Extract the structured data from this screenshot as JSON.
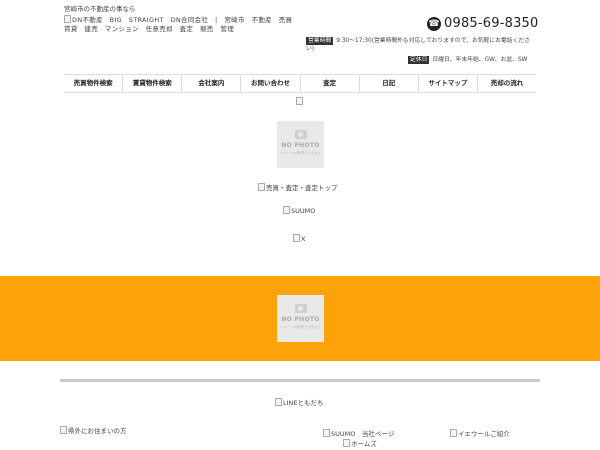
{
  "header": {
    "tagline": "宮崎市の不動産の事なら",
    "logo_alt": "DN不動産　BIG　STRAIGHT　DN合同会社　|　宮崎市　不動産　売買　賃貸　建売　マンション　任意売却　査定　競売　管理",
    "phone": "0985-69-8350",
    "hours_badge": "営業時間",
    "hours_text": "9:30～17:30(営業時間外も対応しておりますので、お気軽にお電話ください)",
    "holiday_badge": "定休日",
    "holiday_text": "日曜日、年末年始、GW、お盆、SW"
  },
  "nav": {
    "items": [
      {
        "label": "売買物件検索"
      },
      {
        "label": "賃貸物件検索"
      },
      {
        "label": "会社案内"
      },
      {
        "label": "お問い合わせ"
      },
      {
        "label": "査定"
      },
      {
        "label": "日記"
      },
      {
        "label": "サイトマップ"
      },
      {
        "label": "売却の流れ"
      }
    ]
  },
  "main": {
    "nophoto_title": "NO PHOTO",
    "nophoto_sub": "イメージが取得できません",
    "link_satei": "売買・査定・査定トップ",
    "link_suumo": "SUUMO",
    "link_x": "X"
  },
  "band": {
    "nophoto_title": "NO PHOTO",
    "nophoto_sub": "イメージが取得できません"
  },
  "footer": {
    "line": "LINEともだち",
    "kengai": "県外にお住まいの方",
    "suumo_page": "SUUMO　当社ページ",
    "homes": "ホームズ",
    "ieul": "イエウールご紹介"
  },
  "colors": {
    "accent_orange": "#fca30a",
    "badge_dark": "#333333"
  }
}
